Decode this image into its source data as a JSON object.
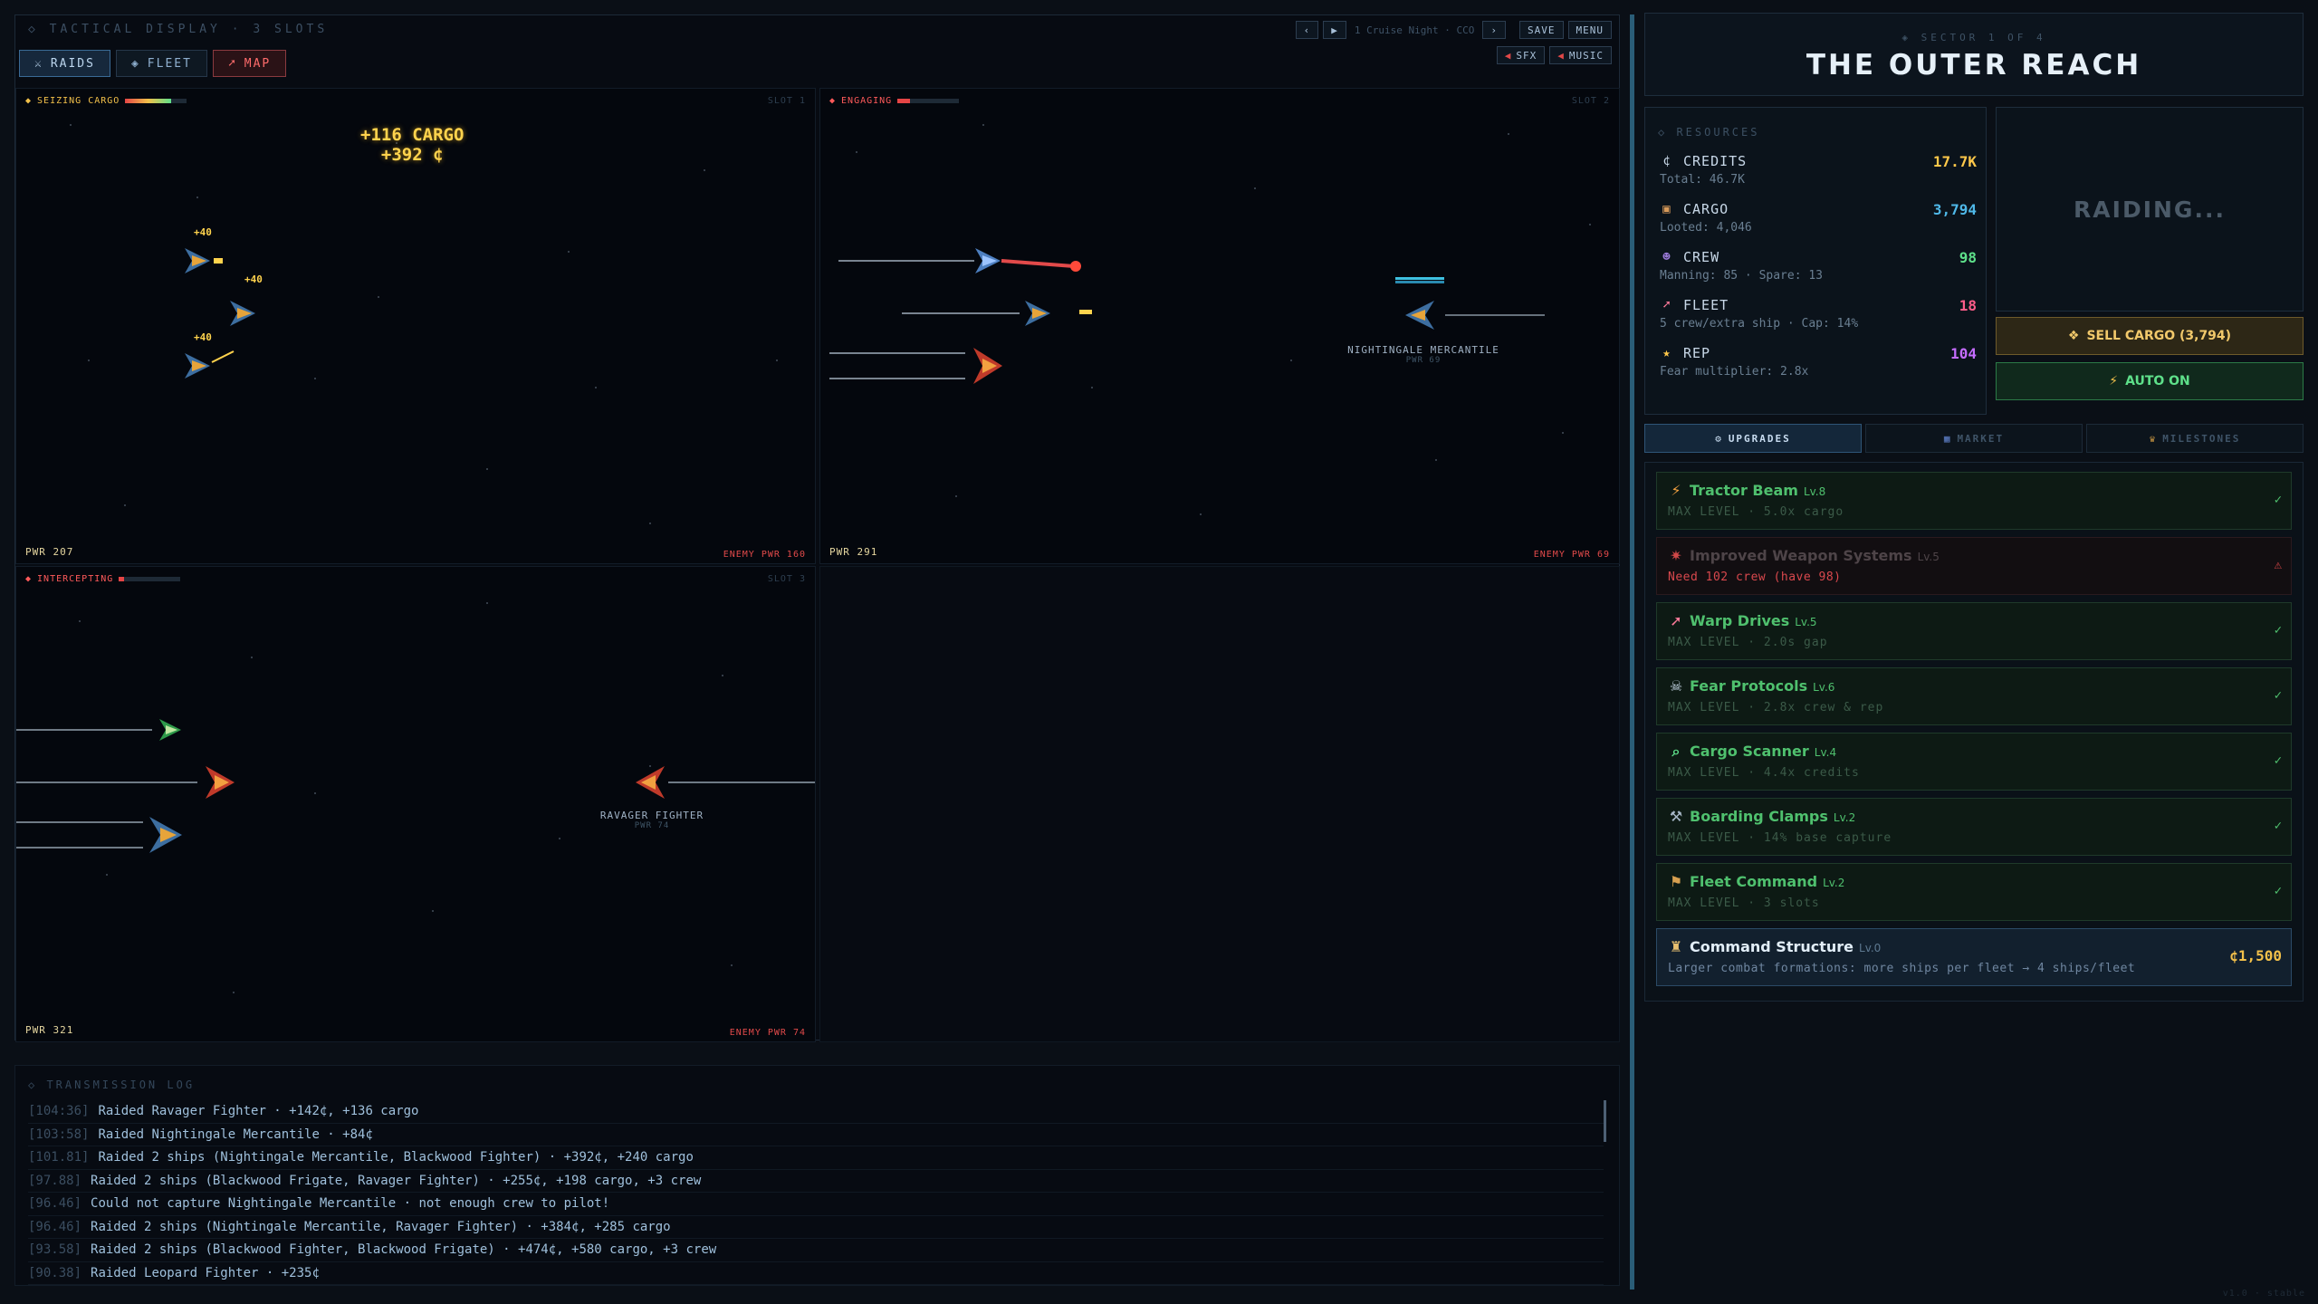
{
  "tactical": {
    "header": "◇ TACTICAL DISPLAY · 3 SLOTS",
    "tabs": [
      {
        "label": "RAIDS",
        "icon": "crossed-swords-icon"
      },
      {
        "label": "FLEET",
        "icon": "diamond-icon"
      },
      {
        "label": "MAP",
        "icon": "rocket-icon"
      }
    ],
    "speed_label": "1 Cruise Night · CCO",
    "controls": {
      "save": "SAVE",
      "menu": "MENU",
      "sfx": "SFX",
      "music": "MUSIC"
    },
    "slots": [
      {
        "status": "SEIZING CARGO",
        "status_color": "#f2c04a",
        "progress": 0.75,
        "slot": "SLOT 1",
        "pwr": "PWR 207",
        "enemy_pwr": "ENEMY PWR 160",
        "float_cargo": "+116 CARGO",
        "float_credits": "+392 ¢",
        "gains": [
          "+40",
          "+40",
          "+40"
        ]
      },
      {
        "status": "ENGAGING",
        "status_color": "#ff5a5a",
        "progress": 0.2,
        "slot": "SLOT 2",
        "pwr": "PWR 291",
        "enemy_pwr": "ENEMY PWR 69",
        "target_name": "NIGHTINGALE MERCANTILE",
        "target_pwr": "PWR 69"
      },
      {
        "status": "INTERCEPTING",
        "status_color": "#ff5a5a",
        "progress": 0.08,
        "slot": "SLOT 3",
        "pwr": "PWR 321",
        "enemy_pwr": "ENEMY PWR 74",
        "target_name": "RAVAGER FIGHTER",
        "target_pwr": "PWR 74"
      }
    ]
  },
  "log": {
    "title": "◇ TRANSMISSION LOG",
    "entries": [
      {
        "time": "[104:36]",
        "text": "Raided Ravager Fighter · +142¢, +136 cargo"
      },
      {
        "time": "[103:58]",
        "text": "Raided Nightingale Mercantile · +84¢"
      },
      {
        "time": "[101.81]",
        "text": "Raided 2 ships (Nightingale Mercantile, Blackwood Fighter) · +392¢, +240 cargo"
      },
      {
        "time": "[97.88]",
        "text": "Raided 2 ships (Blackwood Frigate, Ravager Fighter) · +255¢, +198 cargo, +3 crew"
      },
      {
        "time": "[96.46]",
        "text": "Could not capture Nightingale Mercantile · not enough crew to pilot!"
      },
      {
        "time": "[96.46]",
        "text": "Raided 2 ships (Nightingale Mercantile, Ravager Fighter) · +384¢, +285 cargo"
      },
      {
        "time": "[93.58]",
        "text": "Raided 2 ships (Blackwood Fighter, Blackwood Frigate) · +474¢, +580 cargo, +3 crew"
      },
      {
        "time": "[90.38]",
        "text": "Raided Leopard Fighter · +235¢"
      }
    ]
  },
  "sector": {
    "subtitle": "◈ SECTOR 1 OF 4",
    "title": "THE OUTER REACH"
  },
  "resources": {
    "title": "◇ RESOURCES",
    "items": [
      {
        "icon": "¢",
        "name": "CREDITS",
        "value": "17.7K",
        "sub": "Total: 46.7K",
        "color": "#ffc84a"
      },
      {
        "icon": "▣",
        "name": "CARGO",
        "value": "3,794",
        "sub": "Looted: 4,046",
        "color": "#4fb8e8"
      },
      {
        "icon": "☻",
        "name": "CREW",
        "value": "98",
        "sub": "Manning: 85 · Spare: 13",
        "color": "#5ee08a"
      },
      {
        "icon": "➚",
        "name": "FLEET",
        "value": "18",
        "sub": "5 crew/extra ship · Cap: 14%",
        "color": "#ff5d8a"
      },
      {
        "icon": "★",
        "name": "REP",
        "value": "104",
        "sub": "Fear multiplier: 2.8x",
        "color": "#c46cff"
      }
    ]
  },
  "raid_status": "RAIDING...",
  "sell_button": "SELL CARGO (3,794)",
  "auto_button": "AUTO ON",
  "right_tabs": [
    {
      "label": "UPGRADES",
      "icon": "gear-icon"
    },
    {
      "label": "MARKET",
      "icon": "market-icon"
    },
    {
      "label": "MILESTONES",
      "icon": "trophy-icon"
    }
  ],
  "upgrades": [
    {
      "icon": "⚡",
      "name": "Tractor Beam",
      "lv": "Lv.8",
      "desc": "MAX LEVEL · 5.0x cargo",
      "state": "max",
      "mark": "✓"
    },
    {
      "icon": "✷",
      "name": "Improved Weapon Systems",
      "lv": "Lv.5",
      "desc": "Need 102 crew (have 98)",
      "state": "locked",
      "mark": "⚠"
    },
    {
      "icon": "➚",
      "name": "Warp Drives",
      "lv": "Lv.5",
      "desc": "MAX LEVEL · 2.0s gap",
      "state": "max",
      "mark": "✓"
    },
    {
      "icon": "☠",
      "name": "Fear Protocols",
      "lv": "Lv.6",
      "desc": "MAX LEVEL · 2.8x crew & rep",
      "state": "max",
      "mark": "✓"
    },
    {
      "icon": "⌕",
      "name": "Cargo Scanner",
      "lv": "Lv.4",
      "desc": "MAX LEVEL · 4.4x credits",
      "state": "max",
      "mark": "✓"
    },
    {
      "icon": "⚒",
      "name": "Boarding Clamps",
      "lv": "Lv.2",
      "desc": "MAX LEVEL · 14% base capture",
      "state": "max",
      "mark": "✓"
    },
    {
      "icon": "⚑",
      "name": "Fleet Command",
      "lv": "Lv.2",
      "desc": "MAX LEVEL · 3 slots",
      "state": "max",
      "mark": "✓"
    },
    {
      "icon": "♜",
      "name": "Command Structure",
      "lv": "Lv.0",
      "desc": "Larger combat formations: more ships per fleet → 4 ships/fleet",
      "state": "buy",
      "mark": "¢1,500"
    }
  ],
  "version": "v1.0 · stable"
}
